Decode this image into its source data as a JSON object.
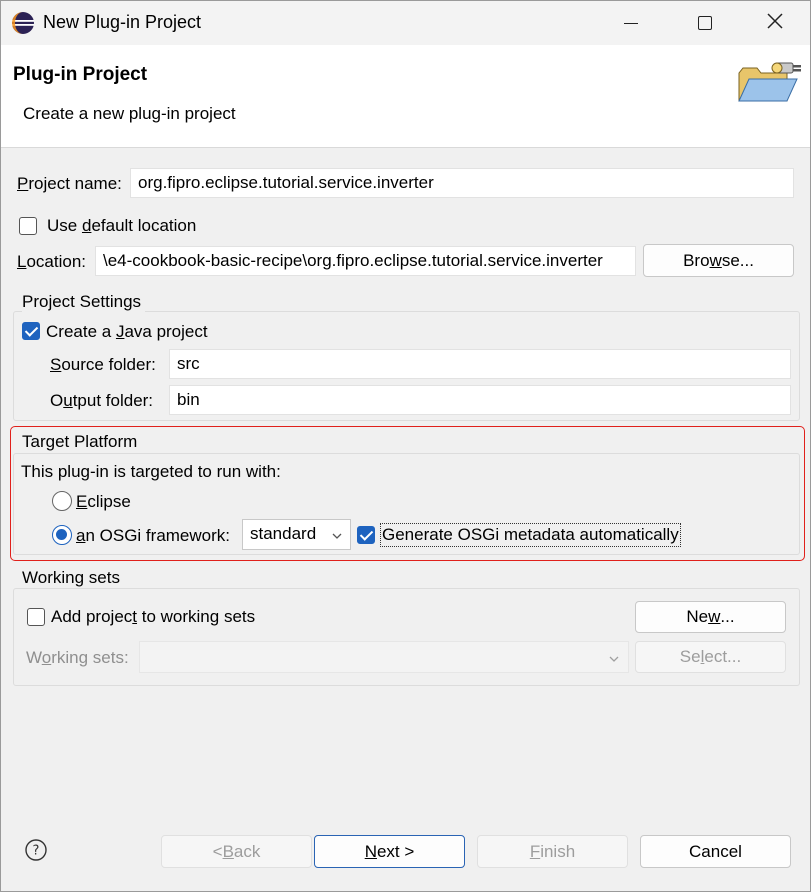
{
  "window": {
    "title": "New Plug-in Project"
  },
  "header": {
    "title": "Plug-in Project",
    "description": "Create a new plug-in project"
  },
  "project": {
    "name_label": "Project name:",
    "name_value": "org.fipro.eclipse.tutorial.service.inverter",
    "use_default_label": "Use default location",
    "use_default_checked": false,
    "location_label": "Location:",
    "location_value": "\\e4-cookbook-basic-recipe\\org.fipro.eclipse.tutorial.service.inverter",
    "browse_label": "Browse..."
  },
  "settings": {
    "group_label": "Project Settings",
    "java_label": "Create a Java project",
    "java_checked": true,
    "source_label": "Source folder:",
    "source_value": "src",
    "output_label": "Output folder:",
    "output_value": "bin"
  },
  "target": {
    "group_label": "Target Platform",
    "intro": "This plug-in is targeted to run with:",
    "eclipse_label": "Eclipse",
    "osgi_label": "an OSGi framework:",
    "osgi_selected": "standard",
    "generate_label": "Generate OSGi metadata automatically",
    "generate_checked": true,
    "highlight_color": "#e0201b"
  },
  "working_sets": {
    "group_label": "Working sets",
    "add_label": "Add project to working sets",
    "add_checked": false,
    "new_label": "New...",
    "sets_label": "Working sets:",
    "select_label": "Select..."
  },
  "footer": {
    "back_label": "< Back",
    "next_label": "Next >",
    "finish_label": "Finish",
    "cancel_label": "Cancel"
  },
  "colors": {
    "accent": "#1e63bf",
    "highlight": "#e0201b"
  }
}
